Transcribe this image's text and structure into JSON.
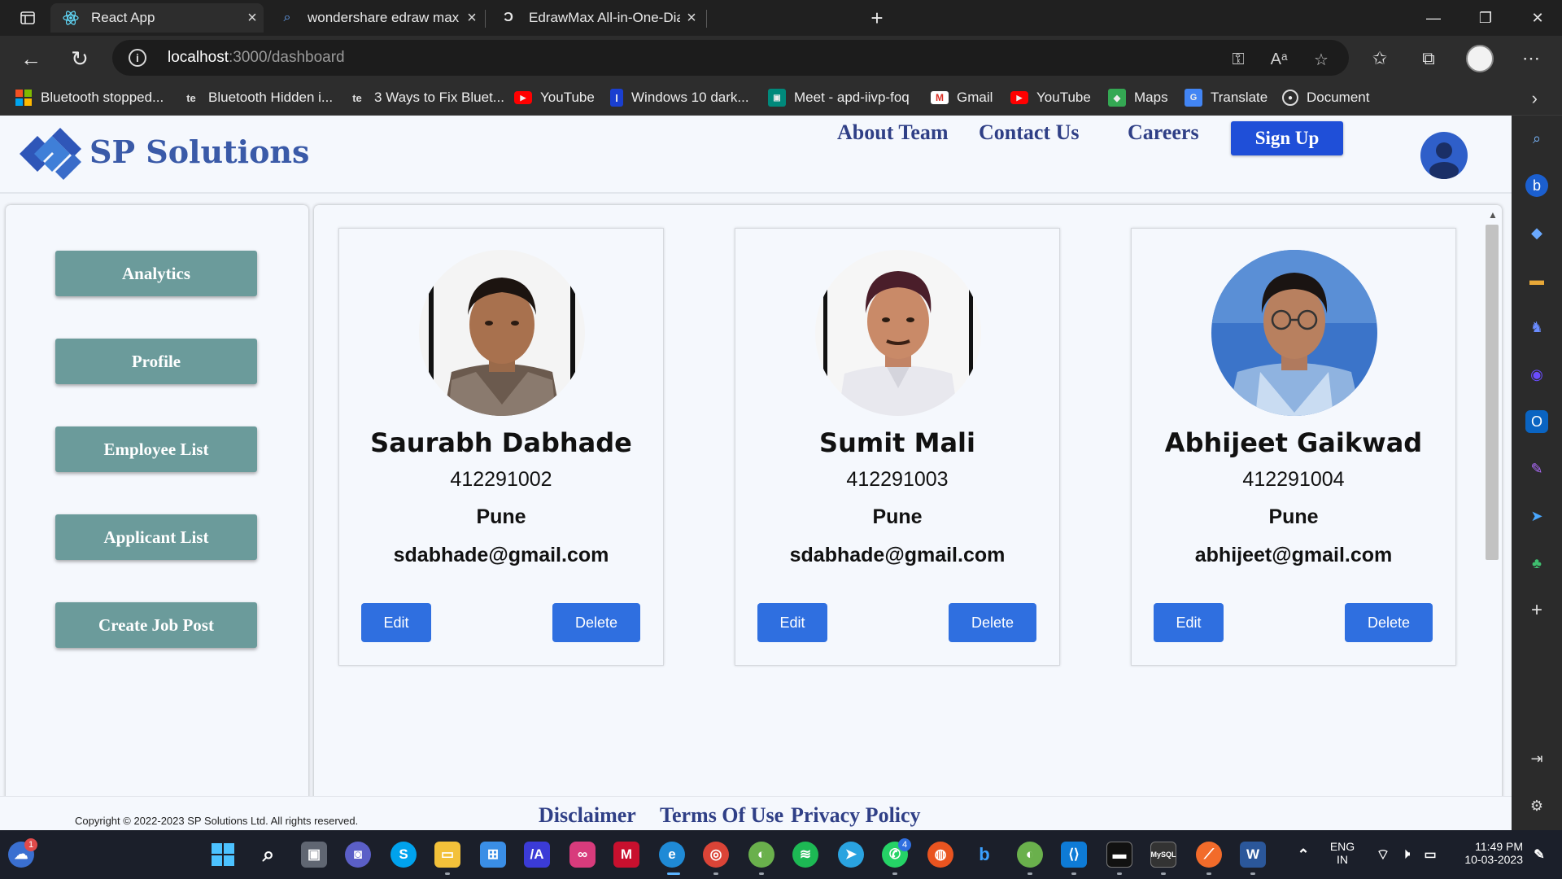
{
  "browser": {
    "tabs": [
      {
        "title": "React App",
        "icon": "react-icon",
        "active": true
      },
      {
        "title": "wondershare edraw max - Searc",
        "icon": "search-icon",
        "active": false
      },
      {
        "title": "EdrawMax All-in-One-Diagram S",
        "icon": "edraw-icon",
        "active": false
      }
    ],
    "url_host": "localhost",
    "url_path": ":3000/dashboard",
    "bookmarks": [
      {
        "label": "Bluetooth stopped...",
        "icon": "windows-logo-icon"
      },
      {
        "label": "Bluetooth Hidden i...",
        "icon": "te-icon"
      },
      {
        "label": "3 Ways to Fix Bluet...",
        "icon": "te-icon"
      },
      {
        "label": "YouTube",
        "icon": "youtube-icon"
      },
      {
        "label": "Windows 10 dark...",
        "icon": "bookmark-i-icon"
      },
      {
        "label": "Meet - apd-iivp-foq",
        "icon": "meet-icon"
      },
      {
        "label": "Gmail",
        "icon": "gmail-icon"
      },
      {
        "label": "YouTube",
        "icon": "youtube-icon"
      },
      {
        "label": "Maps",
        "icon": "maps-icon"
      },
      {
        "label": "Translate",
        "icon": "translate-icon"
      },
      {
        "label": "Document",
        "icon": "github-icon"
      }
    ]
  },
  "site": {
    "brand": "SP Solutions",
    "nav": {
      "about": "About Team",
      "contact": "Contact Us",
      "careers": "Careers",
      "signup": "Sign Up"
    },
    "menu": [
      "Analytics",
      "Profile",
      "Employee List",
      "Applicant List",
      "Create Job Post"
    ],
    "employees": [
      {
        "name": "Saurabh Dabhade",
        "id": "412291002",
        "city": "Pune",
        "email": "sdabhade@gmail.com",
        "edit": "Edit",
        "delete": "Delete"
      },
      {
        "name": "Sumit Mali",
        "id": "412291003",
        "city": "Pune",
        "email": "sdabhade@gmail.com",
        "edit": "Edit",
        "delete": "Delete"
      },
      {
        "name": "Abhijeet Gaikwad",
        "id": "412291004",
        "city": "Pune",
        "email": "abhijeet@gmail.com",
        "edit": "Edit",
        "delete": "Delete"
      }
    ],
    "footer": {
      "copyright": "Copyright © 2022-2023 SP Solutions Ltd. All rights reserved.",
      "disclaimer": "Disclaimer",
      "terms": "Terms Of Use",
      "privacy": "Privacy Policy"
    }
  },
  "taskbar": {
    "lang_top": "ENG",
    "lang_bottom": "IN",
    "time": "11:49 PM",
    "date": "10-03-2023",
    "whatsapp_badge": "4",
    "widget_badge": "1"
  },
  "colors": {
    "menu_button": "#6b9b9b",
    "action_button": "#2f6fe0",
    "signup_button": "#1f4fd8",
    "nav_link": "#2f3f86",
    "brand": "#3a5aa8"
  }
}
